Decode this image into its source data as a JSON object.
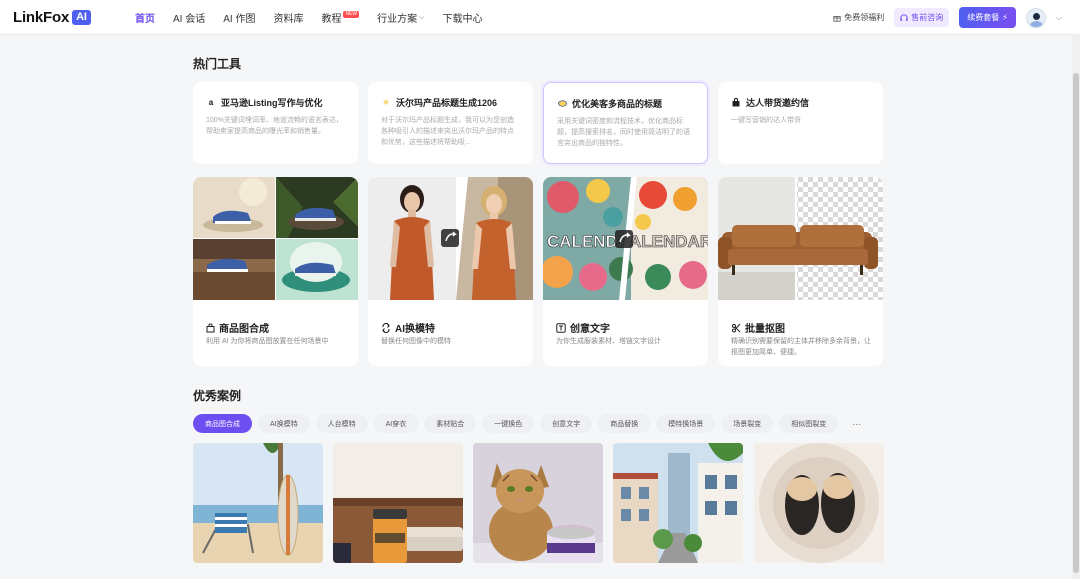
{
  "header": {
    "logo_text": "LinkFox",
    "logo_badge": "AI",
    "nav": [
      {
        "label": "首页",
        "active": true
      },
      {
        "label": "AI 会话"
      },
      {
        "label": "AI 作图"
      },
      {
        "label": "资料库"
      },
      {
        "label": "教程",
        "badge": "NEW"
      },
      {
        "label": "行业方案",
        "dropdown": true
      },
      {
        "label": "下载中心"
      }
    ],
    "free_points": "免费领福利",
    "consult": "售前咨询",
    "package": "续费套餐"
  },
  "hot_tools": {
    "title": "热门工具",
    "items": [
      {
        "icon": "amazon-icon",
        "title": "亚马逊Listing写作与优化",
        "desc": "100%关键词埋词率、地道流畅的语言表达，帮助卖家提高商品的曝光率和销售量。"
      },
      {
        "icon": "walmart-icon",
        "title": "沃尔玛产品标题生成1206",
        "desc": "对于沃尔玛产品标题生成，我可以为您创造各种吸引人的描述来突出沃尔玛产品的特点和优势，这些描述将帮助吸..."
      },
      {
        "icon": "meike-icon",
        "title": "优化美客多商品的标题",
        "desc": "采用关键词密度和流程技术，优化商品标题，提高搜索排名，同时使用简洁明了的语言突出商品的独特性。"
      },
      {
        "icon": "bag-icon",
        "title": "达人带货邀约信",
        "desc": "一键写营销的达人带货"
      }
    ]
  },
  "features": [
    {
      "icon": "bag-icon",
      "name": "商品图合成",
      "desc": "利用 AI 为你将商品图放置在任何场景中"
    },
    {
      "icon": "swap-icon",
      "name": "AI换模特",
      "desc": "替换任何图像中的模特"
    },
    {
      "icon": "text-icon",
      "name": "创意文字",
      "desc": "为你生成服装素材、塔链文字设计"
    },
    {
      "icon": "cutout-icon",
      "name": "批量抠图",
      "desc": "精确识别需要保留的主体并移除多余背景，让抠图更加简单、便捷。"
    }
  ],
  "feature_images": {
    "creative_text_left": "CALENDA",
    "creative_text_right": "ALENDAR"
  },
  "cases": {
    "title": "优秀案例",
    "tabs": [
      "商品图合成",
      "AI换模特",
      "人台模特",
      "AI穿衣",
      "素材贴合",
      "一键换色",
      "创意文字",
      "商品替换",
      "模特换场景",
      "场景裂变",
      "相似图裂变"
    ],
    "active_tab": 0,
    "more": "···"
  },
  "colors": {
    "accent": "#6d4ef0",
    "brand_blue": "#4f5ff0"
  }
}
